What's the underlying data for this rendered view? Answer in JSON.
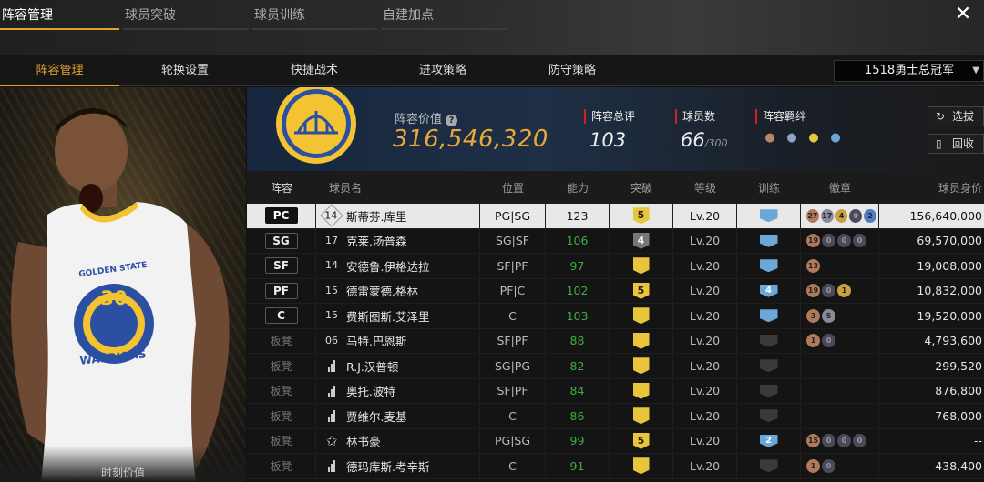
{
  "top_tabs": [
    {
      "label": "阵容管理",
      "active": true
    },
    {
      "label": "球员突破",
      "active": false
    },
    {
      "label": "球员训练",
      "active": false
    },
    {
      "label": "自建加点",
      "active": false
    }
  ],
  "sub_tabs": [
    {
      "label": "阵容管理",
      "active": true
    },
    {
      "label": "轮换设置",
      "active": false
    },
    {
      "label": "快捷战术",
      "active": false
    },
    {
      "label": "进攻策略",
      "active": false
    },
    {
      "label": "防守策略",
      "active": false
    }
  ],
  "team_select": {
    "value": "1518勇士总冠军",
    "caret": "▼"
  },
  "close_icon": "✕",
  "left_panel": {
    "caption": "时刻价值",
    "jersey_team": "GOLDEN STATE",
    "jersey_number": "30",
    "jersey_name": "WARRIORS"
  },
  "info": {
    "value_label": "阵容价值",
    "help_glyph": "?",
    "value": "316,546,320",
    "overall_label": "阵容总评",
    "overall": "103",
    "count_label": "球员数",
    "count": "66",
    "count_max": "/300",
    "bond_label": "阵容羁绊",
    "select_btn": "选拔",
    "recycle_btn": "回收"
  },
  "table": {
    "headers": [
      "阵容",
      "球员名",
      "位置",
      "能力",
      "突破",
      "等级",
      "训练",
      "徽章",
      "球员身价"
    ],
    "rows": [
      {
        "pos": "PC",
        "starter": true,
        "jersey": "14",
        "jersey_style": "diamond",
        "name": "斯蒂芬.库里",
        "role": "PG|SG",
        "ability": "123",
        "ability_color": "white",
        "break": "5",
        "break_style": "gold",
        "level": "Lv.20",
        "train": "",
        "train_style": "blue",
        "badges": [
          "27",
          "17",
          "4",
          "0",
          "2"
        ],
        "value": "156,640,000",
        "selected": true
      },
      {
        "pos": "SG",
        "starter": true,
        "jersey": "17",
        "jersey_style": "circle",
        "name": "克莱.汤普森",
        "role": "SG|SF",
        "ability": "106",
        "ability_color": "green",
        "break": "4",
        "break_style": "grey",
        "level": "Lv.20",
        "train": "",
        "train_style": "blue",
        "badges": [
          "19",
          "0",
          "0",
          "0"
        ],
        "value": "69,570,000",
        "selected": false
      },
      {
        "pos": "SF",
        "starter": true,
        "jersey": "14",
        "jersey_style": "circle",
        "name": "安德鲁.伊格达拉",
        "role": "SF|PF",
        "ability": "97",
        "ability_color": "green",
        "break": "",
        "break_style": "gold",
        "level": "Lv.20",
        "train": "",
        "train_style": "blue",
        "badges": [
          "13"
        ],
        "value": "19,008,000",
        "selected": false
      },
      {
        "pos": "PF",
        "starter": true,
        "jersey": "15",
        "jersey_style": "circle",
        "name": "德雷蒙德.格林",
        "role": "PF|C",
        "ability": "102",
        "ability_color": "green",
        "break": "5",
        "break_style": "gold",
        "level": "Lv.20",
        "train": "4",
        "train_style": "blue",
        "badges": [
          "19",
          "0",
          "1"
        ],
        "value": "10,832,000",
        "selected": false
      },
      {
        "pos": "C",
        "starter": true,
        "jersey": "15",
        "jersey_style": "circle",
        "name": "费斯图斯.艾泽里",
        "role": "C",
        "ability": "103",
        "ability_color": "green",
        "break": "",
        "break_style": "gold",
        "level": "Lv.20",
        "train": "",
        "train_style": "blue",
        "badges": [
          "3",
          "5"
        ],
        "value": "19,520,000",
        "selected": false
      },
      {
        "pos": "板凳",
        "starter": false,
        "jersey": "06",
        "jersey_style": "plain",
        "name": "马特.巴恩斯",
        "role": "SF|PF",
        "ability": "88",
        "ability_color": "green",
        "break": "",
        "break_style": "gold",
        "level": "Lv.20",
        "train": "",
        "train_style": "dim",
        "badges": [
          "1",
          "0"
        ],
        "value": "4,793,600",
        "selected": false
      },
      {
        "pos": "板凳",
        "starter": false,
        "jersey": "",
        "jersey_style": "bars",
        "name": "R.J.汉普顿",
        "role": "SG|PG",
        "ability": "82",
        "ability_color": "green",
        "break": "",
        "break_style": "gold",
        "level": "Lv.20",
        "train": "",
        "train_style": "dim",
        "badges": [],
        "value": "299,520",
        "selected": false
      },
      {
        "pos": "板凳",
        "starter": false,
        "jersey": "",
        "jersey_style": "bars",
        "name": "奥托.波特",
        "role": "SF|PF",
        "ability": "84",
        "ability_color": "green",
        "break": "",
        "break_style": "gold",
        "level": "Lv.20",
        "train": "",
        "train_style": "dim",
        "badges": [],
        "value": "876,800",
        "selected": false
      },
      {
        "pos": "板凳",
        "starter": false,
        "jersey": "",
        "jersey_style": "bars",
        "name": "贾维尔.麦基",
        "role": "C",
        "ability": "86",
        "ability_color": "green",
        "break": "",
        "break_style": "gold",
        "level": "Lv.20",
        "train": "",
        "train_style": "dim",
        "badges": [],
        "value": "768,000",
        "selected": false
      },
      {
        "pos": "板凳",
        "starter": false,
        "jersey": "",
        "jersey_style": "star",
        "name": "林书豪",
        "role": "PG|SG",
        "ability": "99",
        "ability_color": "green",
        "break": "5",
        "break_style": "gold",
        "level": "Lv.20",
        "train": "2",
        "train_style": "blue",
        "badges": [
          "15",
          "0",
          "0",
          "0"
        ],
        "value": "--",
        "selected": false
      },
      {
        "pos": "板凳",
        "starter": false,
        "jersey": "",
        "jersey_style": "bars",
        "name": "德玛库斯.考辛斯",
        "role": "C",
        "ability": "91",
        "ability_color": "green",
        "break": "",
        "break_style": "gold",
        "level": "Lv.20",
        "train": "",
        "train_style": "dim",
        "badges": [
          "1",
          "0"
        ],
        "value": "438,400",
        "selected": false
      }
    ]
  },
  "colors": {
    "accent": "#e6a531",
    "selected_row": "#e8e8e8",
    "green": "#3fae3f",
    "red_marker": "#d02020"
  }
}
